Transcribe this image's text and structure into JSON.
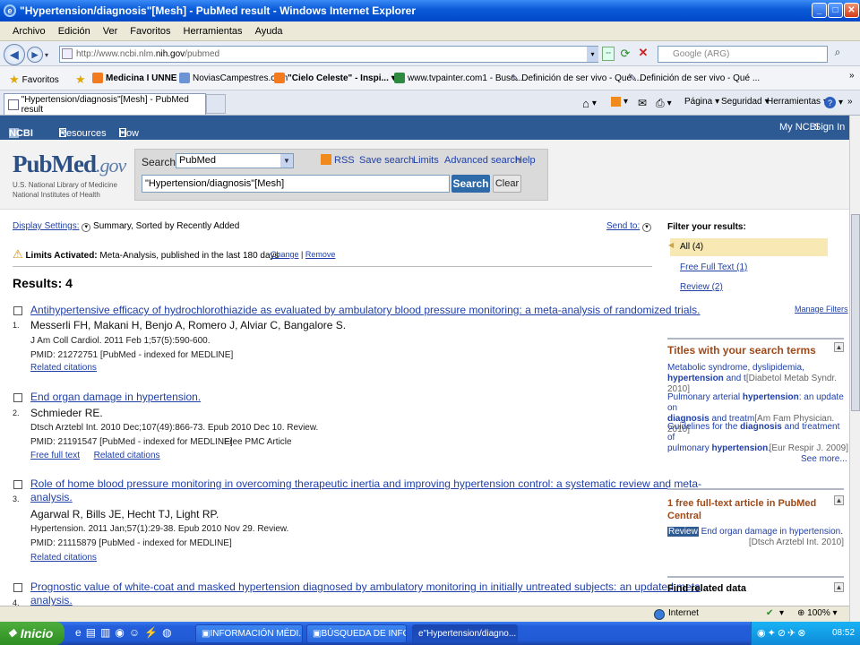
{
  "window": {
    "title": "\"Hypertension/diagnosis\"[Mesh] - PubMed result - Windows Internet Explorer"
  },
  "menu": [
    "Archivo",
    "Edición",
    "Ver",
    "Favoritos",
    "Herramientas",
    "Ayuda"
  ],
  "address": {
    "prefix": "http://www.ncbi.nlm.",
    "host": "nih.gov",
    "path": "/pubmed",
    "search_placeholder": "Google (ARG)"
  },
  "favorites": {
    "label": "Favoritos",
    "items": [
      "Medicina I UNNE",
      "NoviasCampestres.com",
      "\"Cielo Celeste\" - Inspi...",
      "www.tvpainter.com1 - Busc...",
      "Definición de ser vivo - Qué ...",
      "Definición de ser vivo - Qué ..."
    ]
  },
  "tab": {
    "title": "\"Hypertension/diagnosis\"[Mesh] - PubMed result"
  },
  "commands": [
    "Página",
    "Seguridad",
    "Herramientas"
  ],
  "ncbi": {
    "logo": "NCBI",
    "resources": "Resources",
    "howto": "How To",
    "myncbi": "My NCBI",
    "signin": "Sign In"
  },
  "pubmed": {
    "logo_pub": "Pub",
    "logo_med": "Med",
    "logo_gov": ".gov",
    "nlm_line1": "U.S. National Library of Medicine",
    "nlm_line2": "National Institutes of Health",
    "search_label": "Search:",
    "db_selected": "PubMed",
    "links": [
      "RSS",
      "Save search",
      "Limits",
      "Advanced search",
      "Help"
    ],
    "term": "\"Hypertension/diagnosis\"[Mesh]",
    "search_btn": "Search",
    "clear_btn": "Clear"
  },
  "display": {
    "label": "Display Settings:",
    "value": "Summary, Sorted by Recently Added",
    "send_to": "Send to:"
  },
  "limits": {
    "label": "Limits Activated:",
    "value": "Meta-Analysis, published in the last 180 days",
    "change": "Change",
    "sep": "|",
    "remove": "Remove"
  },
  "results_label": "Results: 4",
  "results": [
    {
      "num": "1.",
      "title": "Antihypertensive efficacy of hydrochlorothiazide as evaluated by ambulatory blood pressure monitoring: a meta-analysis of randomized trials.",
      "authors": "Messerli FH, Makani H, Benjo A, Romero J, Alviar C, Bangalore S.",
      "source": "J Am Coll Cardiol. 2011 Feb 1;57(5):590-600.",
      "pmid": "PMID: 21272751 [PubMed - indexed for MEDLINE]",
      "links": [
        "Related citations"
      ]
    },
    {
      "num": "2.",
      "title": "End organ damage in hypertension.",
      "authors": "Schmieder RE.",
      "source": "Dtsch Arztebl Int. 2010 Dec;107(49):866-73. Epub 2010 Dec 10. Review.",
      "pmid": "PMID: 21191547 [PubMed - indexed for MEDLINE]",
      "free": "Free PMC Article",
      "links": [
        "Free full text",
        "Related citations"
      ]
    },
    {
      "num": "3.",
      "title_l1": "Role of home blood pressure monitoring in overcoming therapeutic inertia and improving hypertension control: a systematic review and meta-",
      "title_l2": "analysis.",
      "authors": "Agarwal R, Bills JE, Hecht TJ, Light RP.",
      "source": "Hypertension. 2011 Jan;57(1):29-38. Epub 2010 Nov 29. Review.",
      "pmid": "PMID: 21115879 [PubMed - indexed for MEDLINE]",
      "links": [
        "Related citations"
      ]
    },
    {
      "num": "4.",
      "title_l1": "Prognostic value of white-coat and masked hypertension diagnosed by ambulatory monitoring in initially untreated subjects: an updated meta",
      "title_l2": "analysis."
    }
  ],
  "sidebar": {
    "filter_label": "Filter your results:",
    "filters": [
      "All (4)",
      "Free Full Text (1)",
      "Review (2)"
    ],
    "manage": "Manage Filters",
    "titles_head": "Titles with your search terms",
    "titles": [
      {
        "l1": "Metabolic syndrome, dyslipidemia,",
        "l2a": "hypertension",
        "l2b": " and t",
        "l2c": "[Diabetol Metab Syndr. 2010]"
      },
      {
        "l1a": "Pulmonary arterial ",
        "l1b": "hypertension",
        "l1c": ": an update on",
        "l2a": "diagnosis",
        "l2b": " and treatm",
        "l2c": "[Am Fam Physician. 2010]"
      },
      {
        "l1a": "Guidelines for the ",
        "l1b": "diagnosis",
        "l1c": " and treatment of",
        "l2a": "pulmonary ",
        "l2b": "hypertension",
        "l2c": ".",
        "l2d": "[Eur Respir J. 2009]"
      }
    ],
    "see_more": "See more...",
    "free_head_l1": "1 free full-text article in PubMed",
    "free_head_l2": "Central",
    "free_badge": "Review",
    "free_title": "End organ damage in hypertension.",
    "free_src": "[Dtsch Arztebl Int. 2010]",
    "related_head": "Find related data"
  },
  "status": {
    "zone": "Internet",
    "zoom": "100%"
  },
  "taskbar": {
    "start": "Inicio",
    "tasks": [
      "INFORMACIÓN MÉDI...",
      "BÚSQUEDA DE INFO...",
      "\"Hypertension/diagno..."
    ],
    "time": "08:52"
  },
  "colors": {
    "ncbi_bar": "#2e5a94",
    "link": "#2040a8",
    "side_head": "#a04a18",
    "filter_active": "#f7e8b4"
  }
}
